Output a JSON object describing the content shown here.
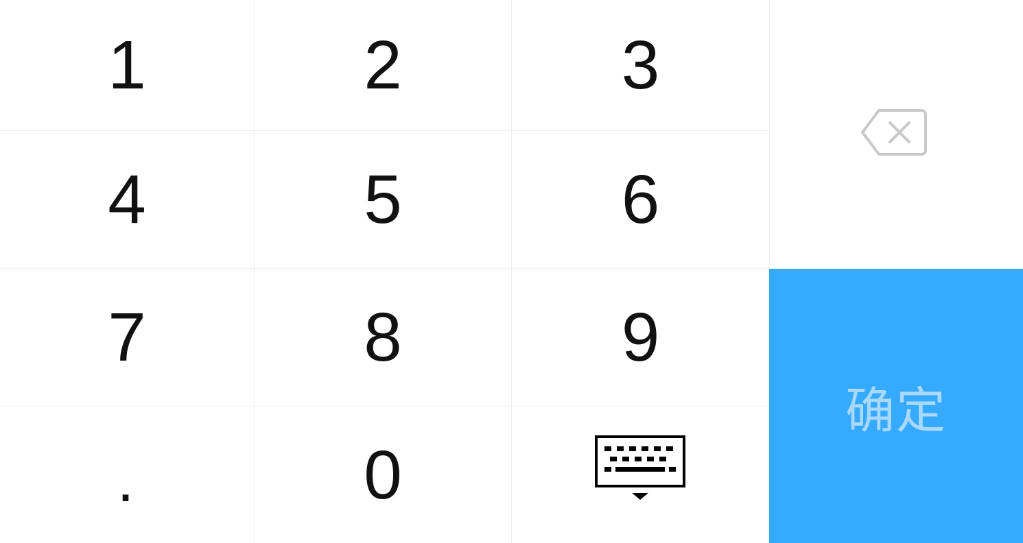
{
  "keypad": {
    "keys": {
      "k1": "1",
      "k2": "2",
      "k3": "3",
      "k4": "4",
      "k5": "5",
      "k6": "6",
      "k7": "7",
      "k8": "8",
      "k9": "9",
      "dot": ".",
      "k0": "0"
    },
    "hide_keyboard_icon": "keyboard-hide-icon",
    "backspace_icon": "backspace-icon",
    "confirm_label": "确定"
  },
  "colors": {
    "confirm_background": "#35aaff",
    "confirm_text": "#a9d8fb",
    "digit_text": "#111111",
    "grid_line": "#eeeeee",
    "backspace_icon": "#c8c8c8"
  }
}
